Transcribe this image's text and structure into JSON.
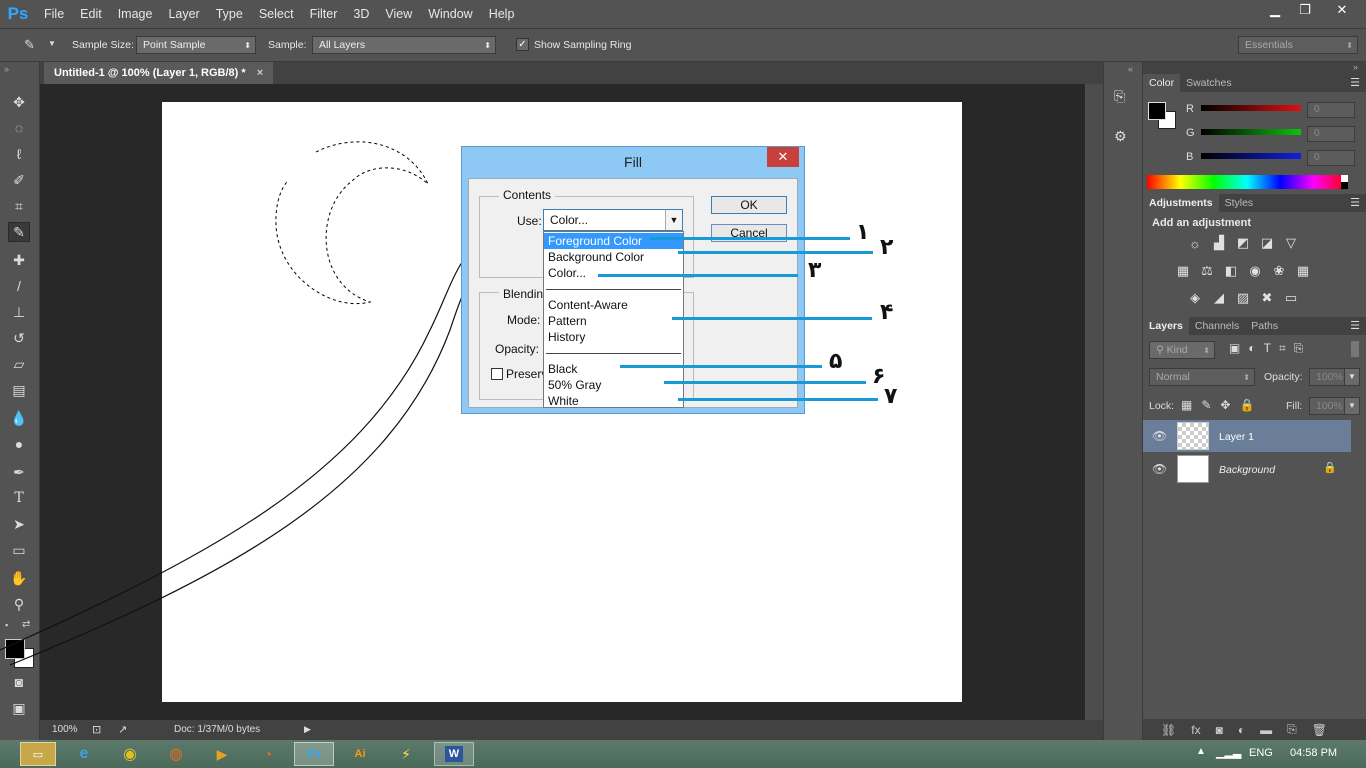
{
  "app": {
    "logo": "Ps"
  },
  "menu": [
    "File",
    "Edit",
    "Image",
    "Layer",
    "Type",
    "Select",
    "Filter",
    "3D",
    "View",
    "Window",
    "Help"
  ],
  "window_controls": {
    "minimize": "▁",
    "restore": "❐",
    "close": "✕"
  },
  "options_bar": {
    "sample_size_label": "Sample Size:",
    "sample_size_value": "Point Sample",
    "sample_label": "Sample:",
    "sample_value": "All Layers",
    "show_ring_label": "Show Sampling Ring",
    "workspace": "Essentials"
  },
  "document_tab": {
    "title": "Untitled-1 @ 100% (Layer 1, RGB/8) *",
    "close": "×"
  },
  "status": {
    "zoom": "100%",
    "doc": "Doc: 1/37M/0 bytes"
  },
  "color_panel": {
    "tabs": [
      "Color",
      "Swatches"
    ],
    "channels": [
      {
        "label": "R",
        "value": "0",
        "color": "#e01010"
      },
      {
        "label": "G",
        "value": "0",
        "color": "#10c010"
      },
      {
        "label": "B",
        "value": "0",
        "color": "#1020e0"
      }
    ]
  },
  "adjustments_panel": {
    "tabs": [
      "Adjustments",
      "Styles"
    ],
    "heading": "Add an adjustment"
  },
  "layers_panel": {
    "tabs": [
      "Layers",
      "Channels",
      "Paths"
    ],
    "kind": "Kind",
    "blend_mode": "Normal",
    "opacity_label": "Opacity:",
    "opacity_value": "100%",
    "lock_label": "Lock:",
    "fill_label": "Fill:",
    "fill_value": "100%",
    "layers": [
      {
        "name": "Layer 1",
        "selected": true
      },
      {
        "name": "Background",
        "selected": false
      }
    ]
  },
  "fill_dialog": {
    "title": "Fill",
    "contents_label": "Contents",
    "use_label": "Use:",
    "use_value": "Color...",
    "blending_label": "Blendin",
    "mode_label": "Mode:",
    "opacity_label": "Opacity:",
    "preserve_label": "Preserv",
    "ok": "OK",
    "cancel": "Cancel",
    "dropdown": {
      "group1": [
        "Foreground Color",
        "Background Color",
        "Color..."
      ],
      "group2": [
        "Content-Aware",
        "Pattern",
        "History"
      ],
      "group3": [
        "Black",
        "50% Gray",
        "White"
      ]
    }
  },
  "callout_numbers": [
    "۱",
    "۲",
    "۳",
    "۴",
    "۵",
    "۶",
    "۷"
  ],
  "taskbar": {
    "lang": "ENG",
    "time": "04:58 PM"
  },
  "accent_color": "#1899d8"
}
